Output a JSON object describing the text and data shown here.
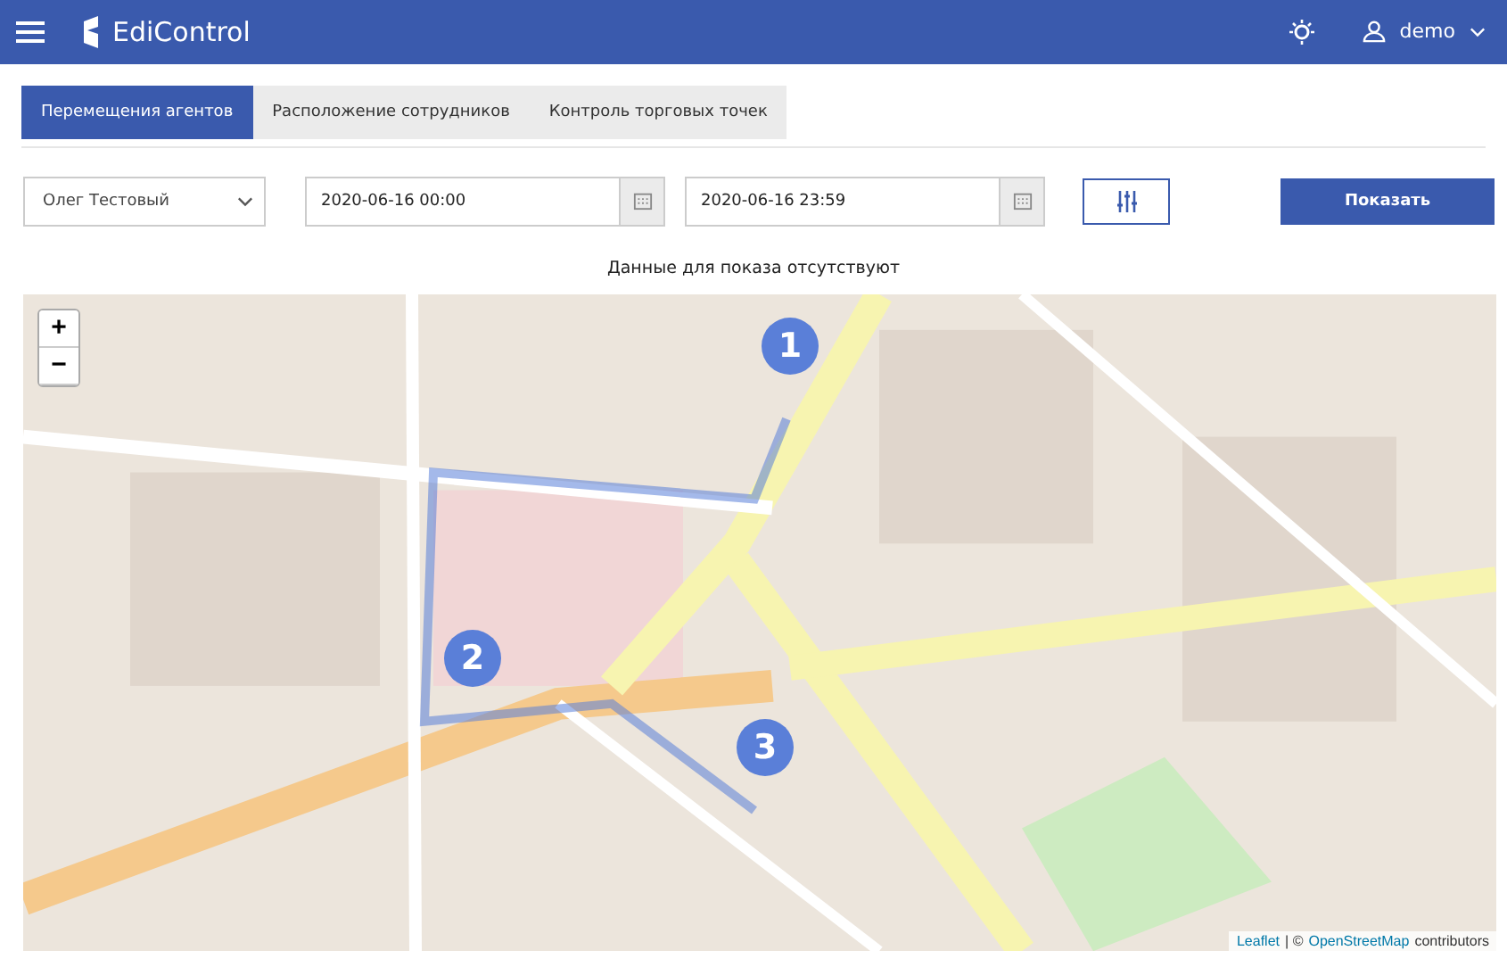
{
  "header": {
    "brand": "EdiControl",
    "user": "demo"
  },
  "tabs": [
    {
      "label": "Перемещения агентов",
      "selected": true
    },
    {
      "label": "Расположение сотрудников",
      "selected": false
    },
    {
      "label": "Контроль торговых точек",
      "selected": false
    }
  ],
  "filters": {
    "agent": "Олег Тестовый",
    "date_from": "2020-06-16 00:00",
    "date_to": "2020-06-16 23:59",
    "submit": "Показать"
  },
  "message": "Данные для показа отсутствуют",
  "map": {
    "zoom_in": "+",
    "zoom_out": "−",
    "markers": [
      {
        "label": "1"
      },
      {
        "label": "2"
      },
      {
        "label": "3"
      }
    ],
    "attribution": {
      "leaflet": "Leaflet",
      "separator": "| ©",
      "osm": "OpenStreetMap",
      "suffix": "contributors"
    }
  }
}
